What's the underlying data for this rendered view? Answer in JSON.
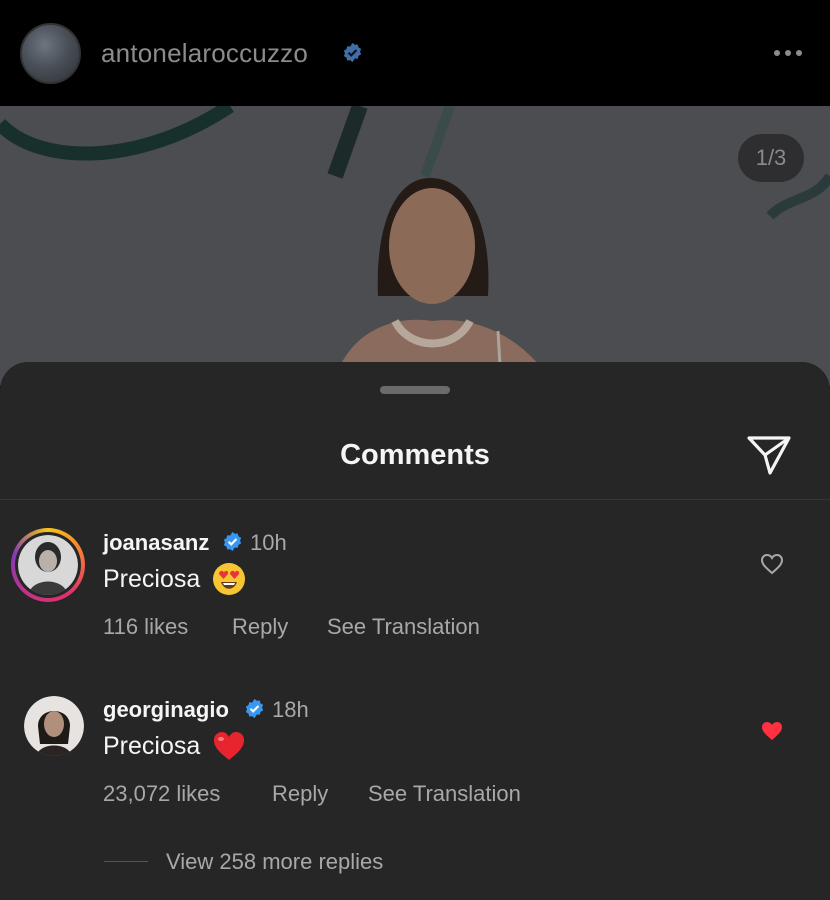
{
  "header": {
    "username": "antonelaroccuzzo",
    "icons": [
      "verified-badge-icon",
      "more-options-icon"
    ]
  },
  "post": {
    "image_counter": "1/3"
  },
  "sheet": {
    "title": "Comments",
    "icons": [
      "drag-handle-icon",
      "share-send-icon"
    ]
  },
  "comments": [
    {
      "username": "joanasanz",
      "time": "10h",
      "text": "Preciosa",
      "emoji": "heart-eyes-emoji",
      "likes": "116 likes",
      "reply_label": "Reply",
      "translate_label": "See Translation",
      "liked": false,
      "has_story_ring": true
    },
    {
      "username": "georginagio",
      "time": "18h",
      "text": "Preciosa",
      "emoji": "red-heart-emoji",
      "likes": "23,072 likes",
      "reply_label": "Reply",
      "translate_label": "See Translation",
      "liked": true,
      "has_story_ring": false
    }
  ],
  "view_more_replies": "View 258 more replies",
  "colors": {
    "background": "#262626",
    "text": "#f5f5f5",
    "muted": "#a8a8a8",
    "verified": "#3897f0",
    "liked_heart": "#ff3040"
  }
}
